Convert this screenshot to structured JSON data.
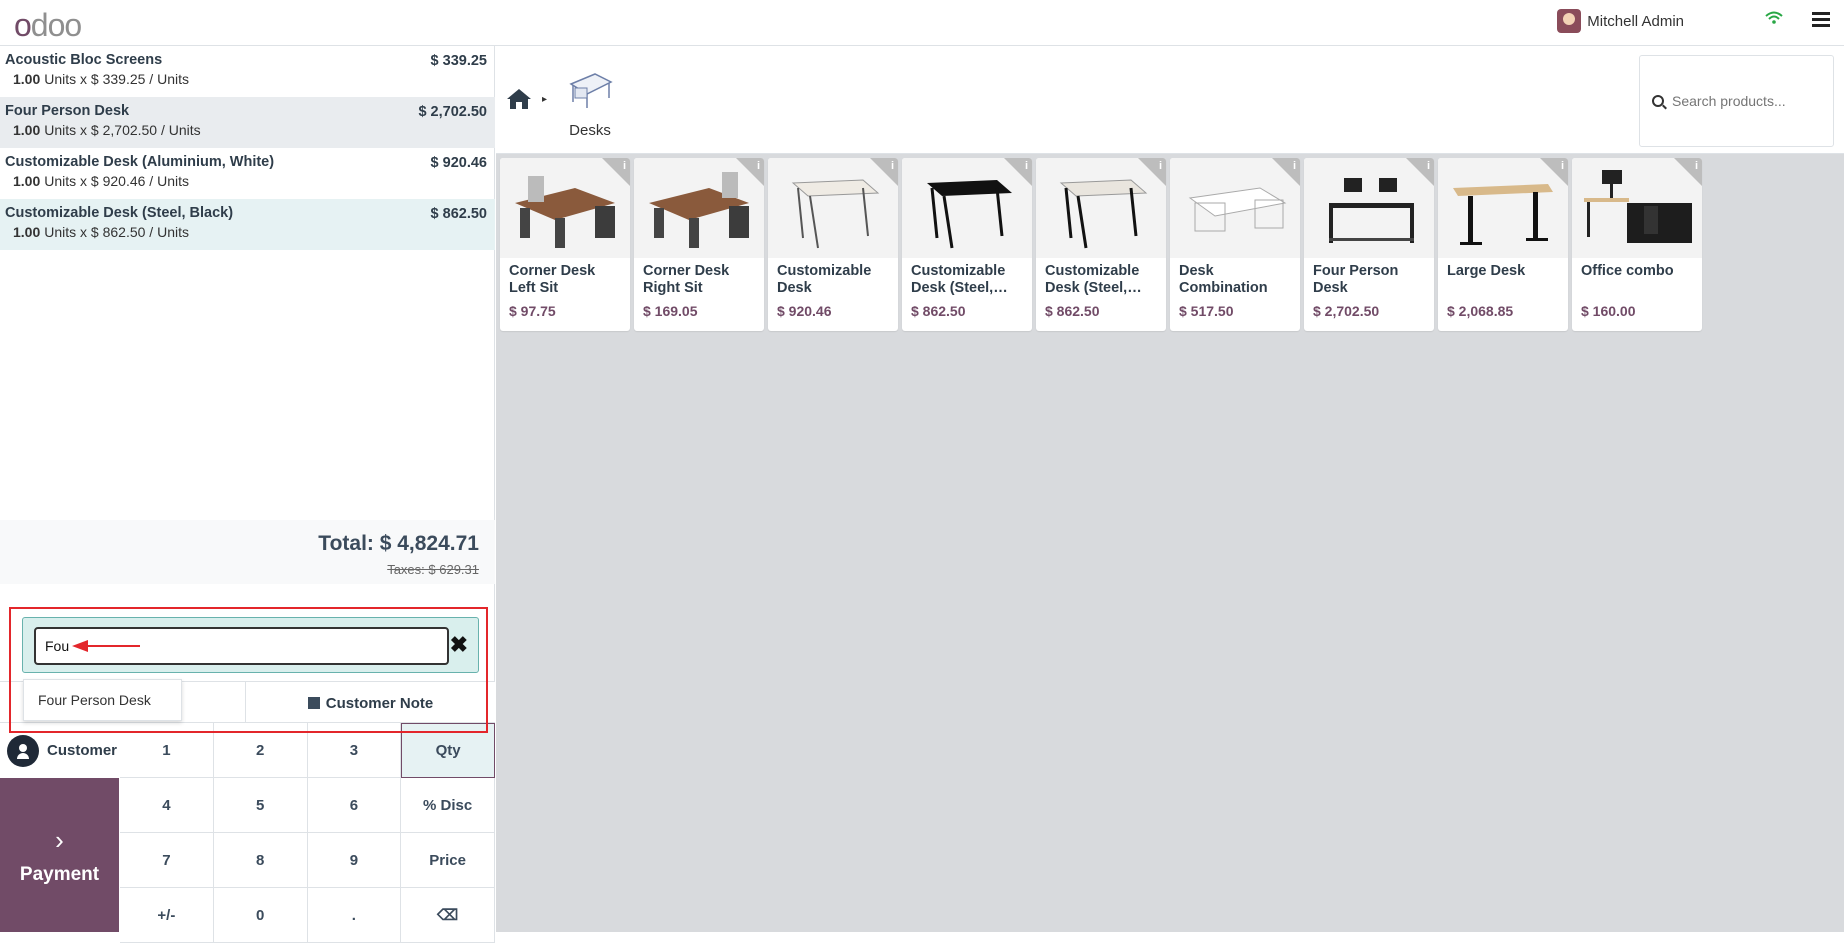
{
  "app": {
    "logo": "odoo"
  },
  "topbar": {
    "user_name": "Mitchell Admin"
  },
  "order": {
    "lines": [
      {
        "name": "Acoustic Bloc Screens",
        "price": "$ 339.25",
        "qty": "1.00",
        "detail": "Units x $ 339.25 / Units"
      },
      {
        "name": "Four Person Desk",
        "price": "$ 2,702.50",
        "qty": "1.00",
        "detail": "Units x $ 2,702.50 / Units"
      },
      {
        "name": "Customizable Desk (Aluminium, White)",
        "price": "$ 920.46",
        "qty": "1.00",
        "detail": "Units x $ 920.46 / Units"
      },
      {
        "name": "Customizable Desk (Steel, Black)",
        "price": "$ 862.50",
        "qty": "1.00",
        "detail": "Units x $ 862.50 / Units"
      }
    ],
    "total": "Total: $ 4,824.71",
    "taxes": "Taxes: $ 629.31"
  },
  "search": {
    "value": "Fou",
    "suggestion": "Four Person Desk"
  },
  "actions": {
    "customer_note": "Customer Note"
  },
  "customer": {
    "label": "Customer"
  },
  "payment": {
    "label": "Payment"
  },
  "numpad": {
    "keys": [
      "1",
      "2",
      "3",
      "Qty",
      "4",
      "5",
      "6",
      "% Disc",
      "7",
      "8",
      "9",
      "Price",
      "+/-",
      "0",
      ".",
      "⌫"
    ]
  },
  "products": {
    "category": "Desks",
    "search_placeholder": "Search products...",
    "items": [
      {
        "name": "Corner Desk Left Sit",
        "price": "$ 97.75"
      },
      {
        "name": "Corner Desk Right Sit",
        "price": "$ 169.05"
      },
      {
        "name": "Customizable Desk (Aluminiu…",
        "price": "$ 920.46"
      },
      {
        "name": "Customizable Desk (Steel,…",
        "price": "$ 862.50"
      },
      {
        "name": "Customizable Desk (Steel,…",
        "price": "$ 862.50"
      },
      {
        "name": "Desk Combination",
        "price": "$ 517.50"
      },
      {
        "name": "Four Person Desk",
        "price": "$ 2,702.50"
      },
      {
        "name": "Large Desk",
        "price": "$ 2,068.85"
      },
      {
        "name": "Office combo",
        "price": "$ 160.00"
      }
    ]
  },
  "colors": {
    "brand": "#714b67",
    "highlight": "#e3262b",
    "selected_line": "#e6f2f3"
  }
}
